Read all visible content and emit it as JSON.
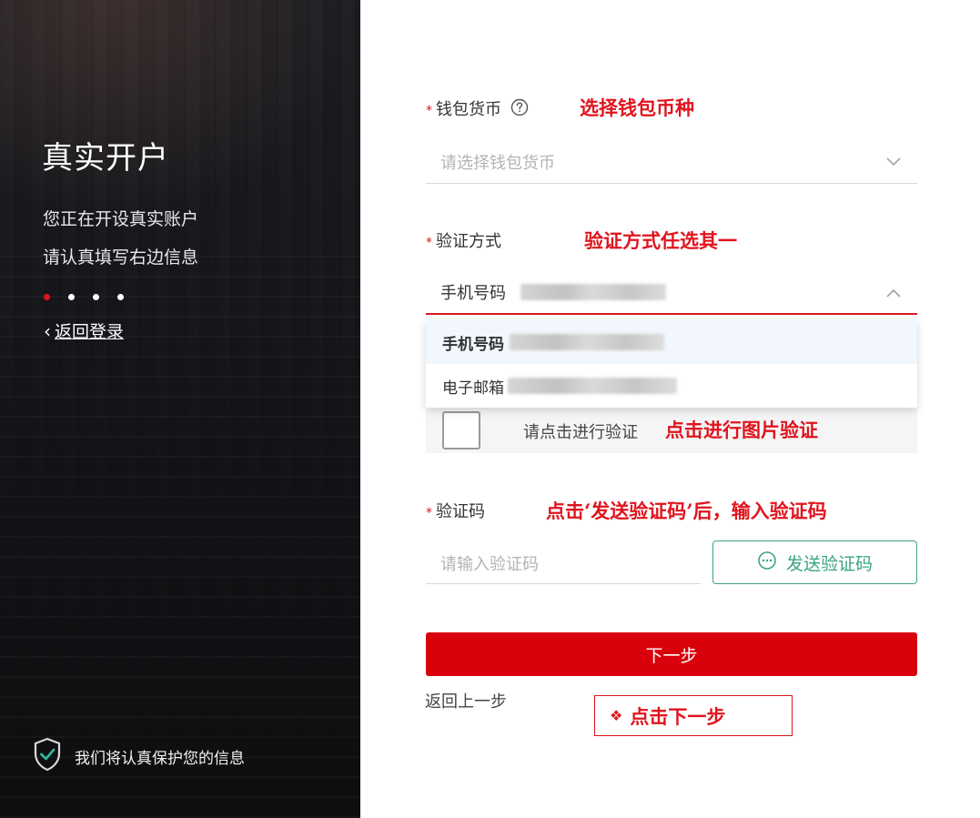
{
  "left": {
    "title": "真实开户",
    "line1": "您正在开设真实账户",
    "line2": "请认真填写右边信息",
    "back": "返回登录",
    "protect": "我们将认真保护您的信息"
  },
  "form": {
    "required_mark": "*",
    "currency_label": "钱包货币",
    "currency_placeholder": "请选择钱包货币",
    "verify_label": "验证方式",
    "verify_value": "手机号码",
    "options": [
      "手机号码",
      "电子邮箱"
    ],
    "captcha_text": "请点击进行验证",
    "code_label": "验证码",
    "code_placeholder": "请输入验证码",
    "send_code": "发送验证码",
    "next": "下一步",
    "prev": "返回上一步"
  },
  "annotations": {
    "currency": "选择钱包币种",
    "verify": "验证方式任选其一",
    "captcha": "点击进行图片验证",
    "code": "点击‘发送验证码’后，输入验证码",
    "next": "点击下一步"
  },
  "colors": {
    "accent_red": "#d9020c",
    "annotation_red": "#e0141e",
    "send_green": "#3aa57f"
  }
}
